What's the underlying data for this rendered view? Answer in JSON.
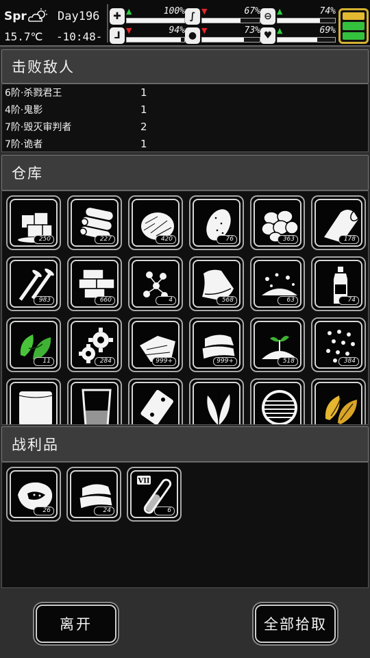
{
  "status": {
    "season": "Spr",
    "temperature": "15.7℃",
    "day": "Day196",
    "time": "-10:48-",
    "stats": [
      {
        "name": "health-icon",
        "arrow": "up",
        "percent_text": "100%",
        "value": 1.0
      },
      {
        "name": "stomach-icon",
        "arrow": "down",
        "percent_text": "67%",
        "value": 0.67
      },
      {
        "name": "pill-icon",
        "arrow": "up",
        "percent_text": "74%",
        "value": 0.74
      },
      {
        "name": "leg-icon",
        "arrow": "down",
        "percent_text": "94%",
        "value": 0.94
      },
      {
        "name": "water-drop-icon",
        "arrow": "down",
        "percent_text": "73%",
        "value": 0.73
      },
      {
        "name": "heart-icon",
        "arrow": "up",
        "percent_text": "69%",
        "value": 0.69
      }
    ],
    "battery_colors": [
      "#e2b930",
      "#34c13d",
      "#34c13d"
    ]
  },
  "defeated": {
    "title": "击败敌人",
    "enemies": [
      {
        "name": "6阶·杀戮君王",
        "count": "1"
      },
      {
        "name": "4阶·鬼影",
        "count": "1"
      },
      {
        "name": "7阶·毁灭审判者",
        "count": "2"
      },
      {
        "name": "7阶·诡者",
        "count": "1"
      }
    ]
  },
  "storage": {
    "title": "仓库",
    "items": [
      {
        "icon": "ice-cubes-icon",
        "qty": "250"
      },
      {
        "icon": "wood-logs-icon",
        "qty": "227"
      },
      {
        "icon": "fiber-pile-icon",
        "qty": "420"
      },
      {
        "icon": "potato-icon",
        "qty": "76"
      },
      {
        "icon": "stones-icon",
        "qty": "363"
      },
      {
        "icon": "cloth-roll-icon",
        "qty": "178"
      },
      {
        "icon": "nails-icon",
        "qty": "983"
      },
      {
        "icon": "bricks-icon",
        "qty": "660"
      },
      {
        "icon": "berries-icon",
        "qty": "4"
      },
      {
        "icon": "leather-icon",
        "qty": "568"
      },
      {
        "icon": "gravel-icon",
        "qty": "63"
      },
      {
        "icon": "oil-bottle-icon",
        "qty": "74"
      },
      {
        "icon": "green-herb-icon",
        "qty": "11"
      },
      {
        "icon": "gears-icon",
        "qty": "284"
      },
      {
        "icon": "paper-sheets-icon",
        "qty": "999+"
      },
      {
        "icon": "folded-cloth-icon",
        "qty": "999+"
      },
      {
        "icon": "soil-sprout-icon",
        "qty": "518"
      },
      {
        "icon": "seeds-icon",
        "qty": "384"
      },
      {
        "icon": "sack-icon",
        "qty": ""
      },
      {
        "icon": "beaker-icon",
        "qty": ""
      },
      {
        "icon": "pack-icon",
        "qty": ""
      },
      {
        "icon": "plant-leaves-icon",
        "qty": ""
      },
      {
        "icon": "grill-icon",
        "qty": ""
      },
      {
        "icon": "yellow-leaves-icon",
        "qty": ""
      }
    ]
  },
  "loot": {
    "title": "战利品",
    "items": [
      {
        "icon": "meat-chunk-icon",
        "qty": "26"
      },
      {
        "icon": "folded-cloth-icon",
        "qty": "24"
      },
      {
        "icon": "vial-vii-icon",
        "qty": "6",
        "label": "VII"
      }
    ]
  },
  "buttons": {
    "leave": "离开",
    "take_all": "全部拾取"
  }
}
